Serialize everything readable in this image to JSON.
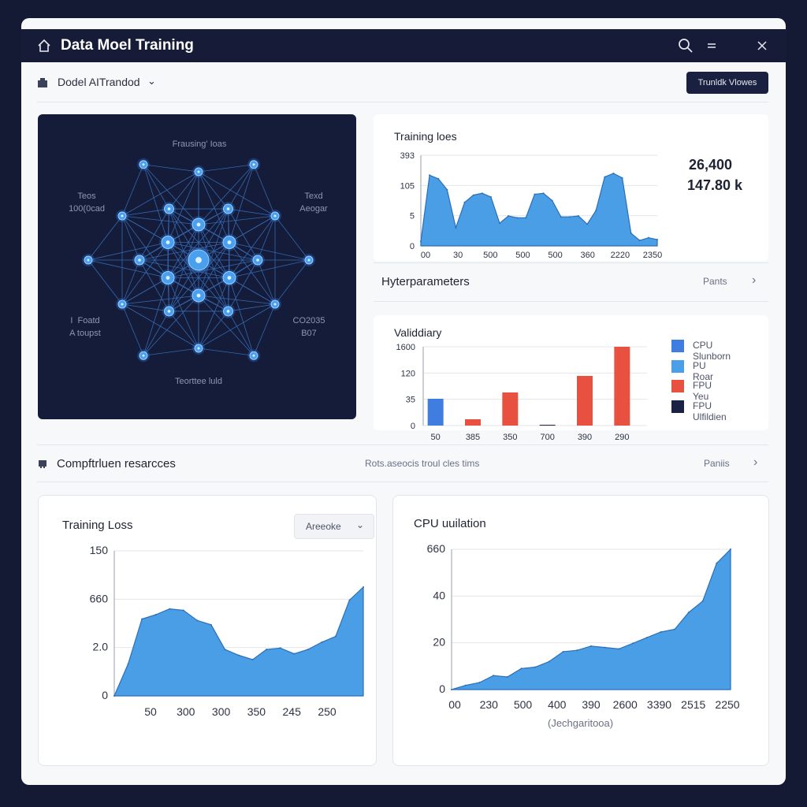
{
  "window": {
    "title": "Data Moel Training",
    "icons": [
      "home-icon",
      "search-icon",
      "menu-icon",
      "close-icon"
    ]
  },
  "toolbar": {
    "model_label": "Dodel AITrandod",
    "button_label": "Trunldk Vlowes"
  },
  "network": {
    "top_label": "Frausing' Ioas",
    "left_label": "Teos\n100(0cad",
    "right_label": "Texd\nAeogar",
    "lower_left_label": "I  Foatd\nA toupst",
    "lower_right_label": "CO2035\nB07",
    "bottom_label": "Teorttee luld"
  },
  "training_loss_small": {
    "title": "Training loes",
    "stat1": "26,400",
    "stat2": "147.80 k"
  },
  "hyperparameters": {
    "label": "Hyterparameters",
    "link": "Pants"
  },
  "validation": {
    "title": "Validdiary",
    "legend": [
      {
        "label": "CPU Slunborn",
        "color": "#3f7ee0"
      },
      {
        "label": "PU Roar",
        "color": "#4b9fe8"
      },
      {
        "label": "FPU Yeu",
        "color": "#e8513f"
      },
      {
        "label": "FPU Ulfildien",
        "color": "#1b2142"
      }
    ]
  },
  "resources": {
    "label": "Compftrluen resarcces",
    "center_text": "Rots.aseocis troul cles tims",
    "link": "Paniis"
  },
  "training_loss_large": {
    "title": "Training Loss",
    "dropdown": "Areeoke"
  },
  "cpu_utilization": {
    "title": "CPU uuilation",
    "xlabel": "(Jechgaritooa)"
  },
  "colors": {
    "accent": "#4a9ee6",
    "dark": "#161c38",
    "red": "#e8513f"
  },
  "chart_data": [
    {
      "type": "area",
      "id": "training_loss_small",
      "title": "Training loes",
      "y_ticks": [
        "0",
        "5",
        "105",
        "393"
      ],
      "x_ticks": [
        "00",
        "30",
        "500",
        "500",
        "500",
        "360",
        "2220",
        "2350"
      ],
      "values": [
        0.05,
        0.78,
        0.74,
        0.62,
        0.2,
        0.48,
        0.56,
        0.58,
        0.54,
        0.25,
        0.33,
        0.31,
        0.31,
        0.57,
        0.58,
        0.5,
        0.32,
        0.32,
        0.33,
        0.24,
        0.39,
        0.76,
        0.8,
        0.75,
        0.14,
        0.06,
        0.09,
        0.07
      ]
    },
    {
      "type": "bar",
      "id": "validation",
      "title": "Validdiary",
      "y_ticks": [
        "0",
        "35",
        "120",
        "1600"
      ],
      "x_ticks": [
        "50",
        "385",
        "350",
        "700",
        "390",
        "290"
      ],
      "bars": [
        {
          "value": 0.34,
          "color": "#3f7ee0"
        },
        {
          "value": 0.08,
          "color": "#e8513f"
        },
        {
          "value": 0.42,
          "color": "#e8513f"
        },
        {
          "value": 0.01,
          "color": "#1b2142"
        },
        {
          "value": 0.63,
          "color": "#e8513f"
        },
        {
          "value": 1.0,
          "color": "#e8513f"
        }
      ]
    },
    {
      "type": "area",
      "id": "training_loss_large",
      "title": "Training Loss",
      "y_ticks": [
        "0",
        "2.0",
        "660",
        "150"
      ],
      "x_ticks": [
        "50",
        "300",
        "300",
        "350",
        "245",
        "250"
      ],
      "values": [
        0.0,
        0.22,
        0.53,
        0.56,
        0.6,
        0.59,
        0.52,
        0.49,
        0.32,
        0.28,
        0.25,
        0.32,
        0.33,
        0.29,
        0.32,
        0.37,
        0.41,
        0.66,
        0.75
      ]
    },
    {
      "type": "area",
      "id": "cpu_utilization",
      "title": "CPU uuilation",
      "xlabel": "(Jechgaritooa)",
      "y_ticks": [
        "0",
        "20",
        "40",
        "660"
      ],
      "x_ticks": [
        "00",
        "230",
        "500",
        "400",
        "390",
        "2600",
        "3390",
        "2515",
        "2250"
      ],
      "values": [
        0.0,
        0.03,
        0.05,
        0.1,
        0.09,
        0.15,
        0.16,
        0.2,
        0.27,
        0.28,
        0.31,
        0.3,
        0.29,
        0.33,
        0.37,
        0.41,
        0.43,
        0.55,
        0.63,
        0.9,
        1.0
      ]
    }
  ]
}
